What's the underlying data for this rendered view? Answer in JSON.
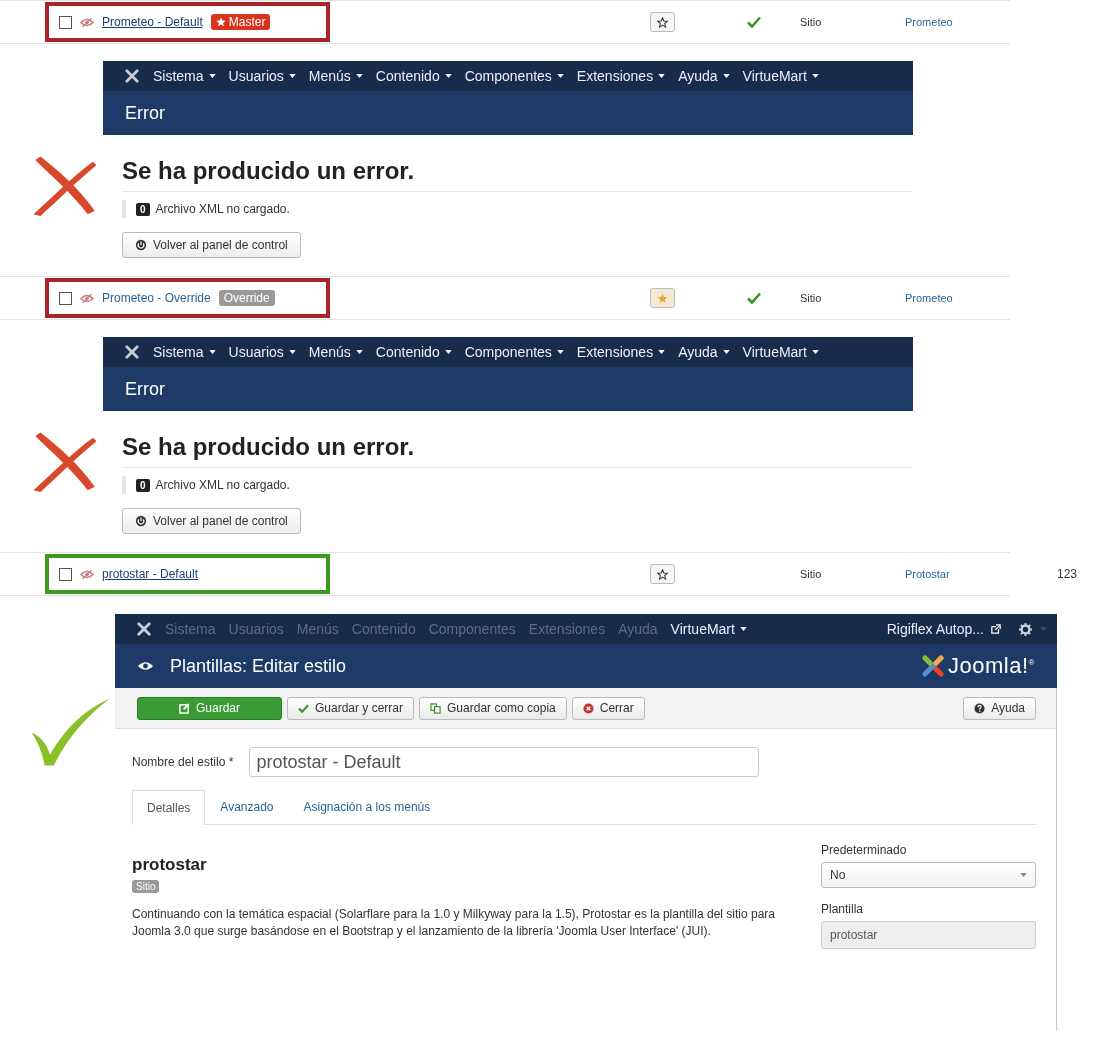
{
  "blocks": [
    {
      "kind": "template_row",
      "color": "#a8232a",
      "checked": false,
      "name": "Prometeo - Default",
      "underlined": true,
      "badge": {
        "kind": "master",
        "text": "Master"
      },
      "default": false,
      "home": true,
      "location": "Sitio",
      "template": "Prometeo"
    },
    {
      "kind": "error_page",
      "menu": [
        {
          "label": "Sistema",
          "dropdown": true,
          "disabled": false
        },
        {
          "label": "Usuarios",
          "dropdown": true,
          "disabled": false
        },
        {
          "label": "Menús",
          "dropdown": true,
          "disabled": false
        },
        {
          "label": "Contenido",
          "dropdown": true,
          "disabled": false
        },
        {
          "label": "Componentes",
          "dropdown": true,
          "disabled": false
        },
        {
          "label": "Extensiones",
          "dropdown": true,
          "disabled": false
        },
        {
          "label": "Ayuda",
          "dropdown": true,
          "disabled": false
        },
        {
          "label": "VirtueMart",
          "dropdown": true,
          "disabled": false
        }
      ],
      "heading": "Error",
      "title": "Se ha producido un error.",
      "code": "0",
      "message": "Archivo XML no cargado.",
      "button": "Volver al panel de control"
    },
    {
      "kind": "template_row",
      "color": "#a8232a",
      "checked": false,
      "name": "Prometeo - Override",
      "underlined": false,
      "badge": {
        "kind": "override",
        "text": "Override"
      },
      "default": true,
      "home": true,
      "location": "Sitio",
      "template": "Prometeo"
    },
    {
      "kind": "error_page",
      "menu": [
        {
          "label": "Sistema",
          "dropdown": true,
          "disabled": false
        },
        {
          "label": "Usuarios",
          "dropdown": true,
          "disabled": false
        },
        {
          "label": "Menús",
          "dropdown": true,
          "disabled": false
        },
        {
          "label": "Contenido",
          "dropdown": true,
          "disabled": false
        },
        {
          "label": "Componentes",
          "dropdown": true,
          "disabled": false
        },
        {
          "label": "Extensiones",
          "dropdown": true,
          "disabled": false
        },
        {
          "label": "Ayuda",
          "dropdown": true,
          "disabled": false
        },
        {
          "label": "VirtueMart",
          "dropdown": true,
          "disabled": false
        }
      ],
      "heading": "Error",
      "title": "Se ha producido un error.",
      "code": "0",
      "message": "Archivo XML no cargado.",
      "button": "Volver al panel de control"
    },
    {
      "kind": "template_row",
      "color": "#3d9a1f",
      "checked": false,
      "name": "protostar - Default",
      "underlined": true,
      "default": false,
      "home": false,
      "location": "Sitio",
      "template": "Protostar",
      "id": "123"
    },
    {
      "kind": "edit_page",
      "menu": [
        {
          "label": "Sistema",
          "dropdown": false,
          "disabled": true
        },
        {
          "label": "Usuarios",
          "dropdown": false,
          "disabled": true
        },
        {
          "label": "Menús",
          "dropdown": false,
          "disabled": true
        },
        {
          "label": "Contenido",
          "dropdown": false,
          "disabled": true
        },
        {
          "label": "Componentes",
          "dropdown": false,
          "disabled": true
        },
        {
          "label": "Extensiones",
          "dropdown": false,
          "disabled": true
        },
        {
          "label": "Ayuda",
          "dropdown": false,
          "disabled": true
        },
        {
          "label": "VirtueMart",
          "dropdown": true,
          "disabled": false
        }
      ],
      "user_menu": "Rigiflex Autop...",
      "heading": "Plantillas: Editar estilo",
      "logo": "Joomla!$^{®}$",
      "toolbar": [
        {
          "kind": "save",
          "label": "Guardar"
        },
        {
          "kind": "save_close",
          "label": "Guardar y cerrar"
        },
        {
          "kind": "save_copy",
          "label": "Guardar como copia"
        },
        {
          "kind": "close",
          "label": "Cerrar"
        },
        {
          "kind": "help",
          "label": "Ayuda"
        }
      ],
      "style_name": {
        "label": "Nombre del estilo *",
        "value": "protostar - Default"
      },
      "tabs": [
        {
          "label": "Detalles",
          "selected": true
        },
        {
          "label": "Avanzado",
          "selected": false
        },
        {
          "label": "Asignación a los menús",
          "selected": false
        }
      ],
      "template_title": "protostar",
      "client_badge": "Sitio",
      "description": "Continuando con la temática espacial (Solarflare para la 1.0 y Milkyway para la 1.5), Protostar es la plantilla del sitio para Joomla 3.0 que surge basándose en el Bootstrap y el lanzamiento de la librería 'Joomla User Interface' (JUI).",
      "side_fields": [
        {
          "kind": "select",
          "label": "Predeterminado",
          "value": "No"
        },
        {
          "kind": "readonly",
          "label": "Plantilla",
          "value": "protostar"
        }
      ]
    }
  ]
}
